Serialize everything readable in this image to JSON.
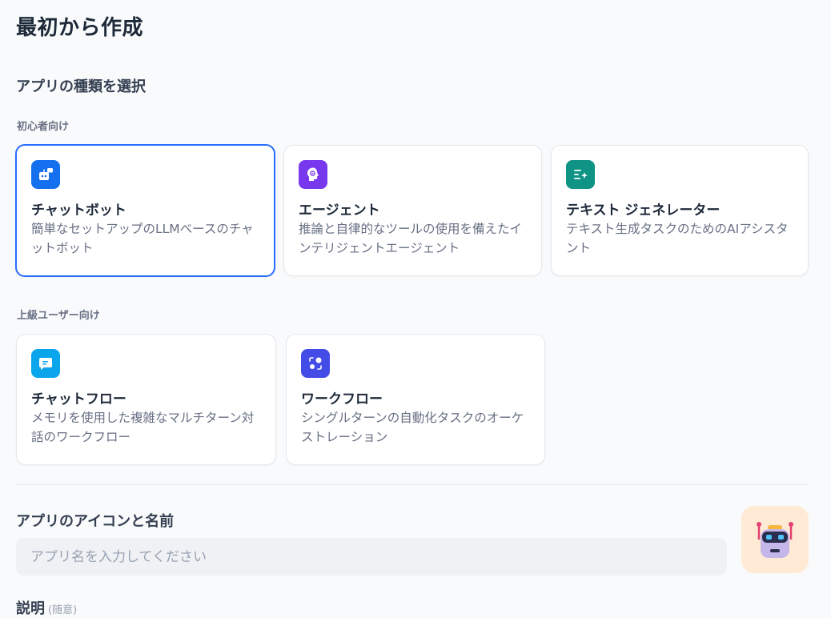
{
  "page_title": "最初から作成",
  "app_type": {
    "heading": "アプリの種類を選択",
    "beginner": {
      "label": "初心者向け",
      "cards": [
        {
          "title": "チャットボット",
          "description": "簡単なセットアップのLLMベースのチャットボット",
          "icon": "chatbot-icon",
          "icon_color": "#1570ef",
          "selected": true
        },
        {
          "title": "エージェント",
          "description": "推論と自律的なツールの使用を備えたインテリジェントエージェント",
          "icon": "agent-icon",
          "icon_color": "#7839ee",
          "selected": false
        },
        {
          "title": "テキスト ジェネレーター",
          "description": "テキスト生成タスクのためのAIアシスタント",
          "icon": "text-generator-icon",
          "icon_color": "#0e9384",
          "selected": false
        }
      ]
    },
    "advanced": {
      "label": "上級ユーザー向け",
      "cards": [
        {
          "title": "チャットフロー",
          "description": "メモリを使用した複雑なマルチターン対話のワークフロー",
          "icon": "chatflow-icon",
          "icon_color": "#0ba5ec",
          "selected": false
        },
        {
          "title": "ワークフロー",
          "description": "シングルターンの自動化タスクのオーケストレーション",
          "icon": "workflow-icon",
          "icon_color": "#444ce7",
          "selected": false
        }
      ]
    }
  },
  "app_name": {
    "heading": "アプリのアイコンと名前",
    "placeholder": "アプリ名を入力してください",
    "value": "",
    "icon": "robot-emoji-icon",
    "icon_background": "#ffead5"
  },
  "description": {
    "heading": "説明",
    "optional": "(随意)"
  },
  "colors": {
    "accent": "#296dff",
    "page_background": "#f9fafb"
  }
}
